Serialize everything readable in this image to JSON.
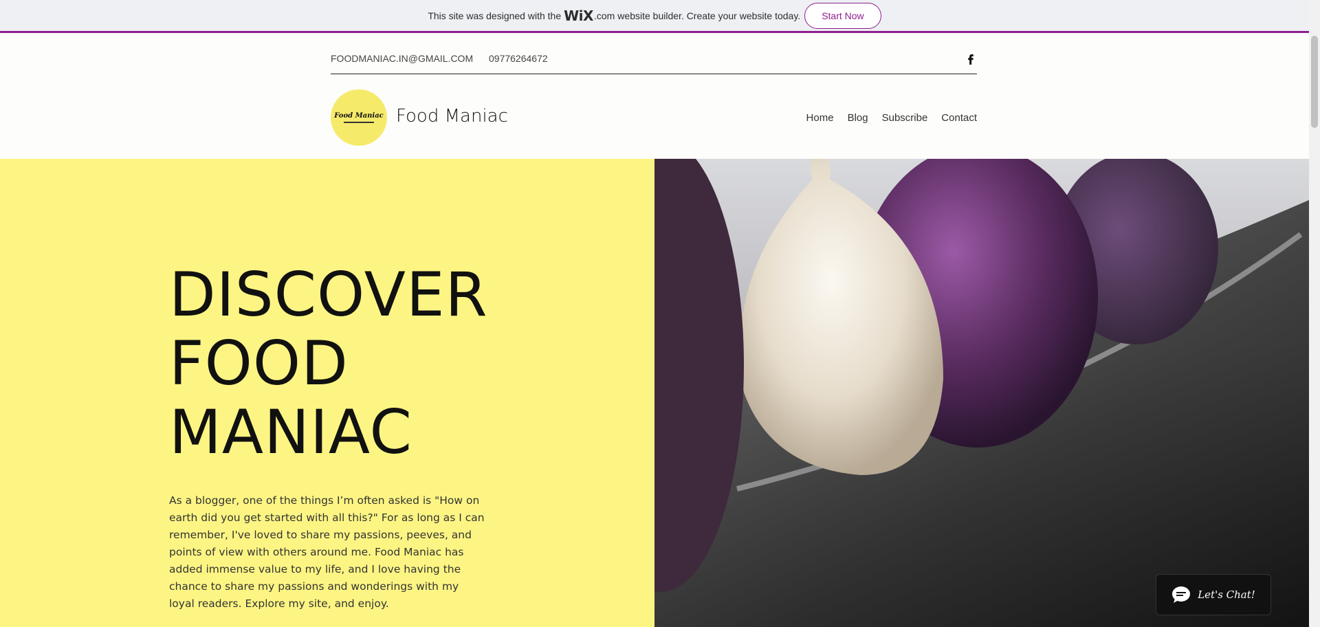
{
  "banner": {
    "text_before": "This site was designed with the",
    "brand": "WiX",
    "brand_tld": ".com",
    "text_after": "website builder. Create your website today.",
    "cta_label": "Start Now",
    "accent_color": "#8e1f8e"
  },
  "contact": {
    "email": "FOODMANIAC.IN@GMAIL.COM",
    "phone": "09776264672",
    "social_icon": "facebook-icon"
  },
  "header": {
    "logo_text": "Food Maniac",
    "site_title": "Food Maniac",
    "nav": [
      "Home",
      "Blog",
      "Subscribe",
      "Contact"
    ]
  },
  "hero": {
    "title_lines": [
      "DISCOVER",
      "FOOD",
      "MANIAC"
    ],
    "body": "As a blogger, one of the things I’m often asked is \"How on earth did you get started with all this?\" For as long as I can remember, I've loved to share my passions, peeves, and points of view with others around me. Food Maniac has added immense value to my life, and I love having the chance to share my passions and wonderings with my loyal readers. Explore my site, and enjoy.",
    "background_color": "#fdf583",
    "image_subject": "garlic and figs on a dark plate"
  },
  "chat": {
    "label": "Let's Chat!",
    "icon": "chat-bubble-icon"
  }
}
